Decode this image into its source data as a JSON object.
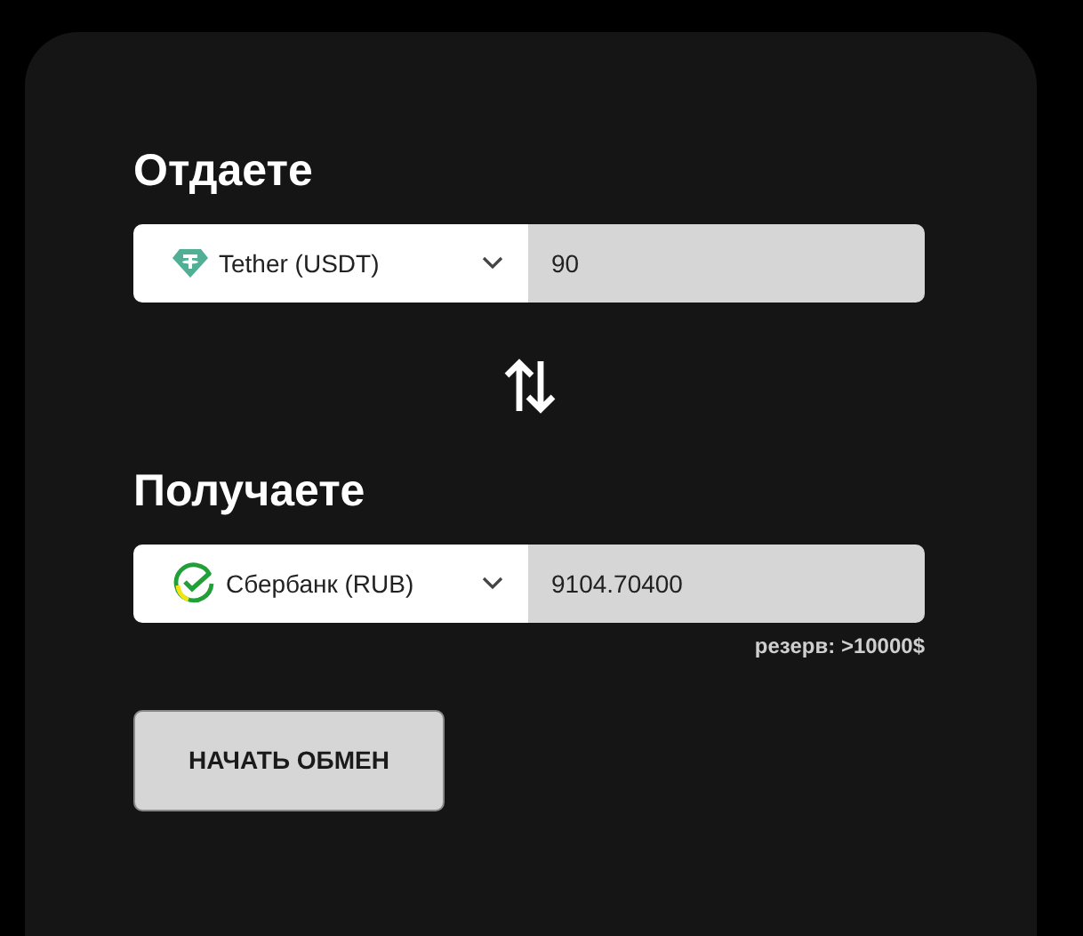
{
  "sections": [
    {
      "heading": "Отдаете",
      "currency": {
        "kind": "tether",
        "label": "Tether (USDT)"
      },
      "amount": "90"
    },
    {
      "heading": "Получаете",
      "currency": {
        "kind": "sber",
        "label": "Сбербанк (RUB)"
      },
      "amount": "9104.70400",
      "reserve": "резерв: >10000$"
    }
  ],
  "button": "НАЧАТЬ ОБМЕН"
}
